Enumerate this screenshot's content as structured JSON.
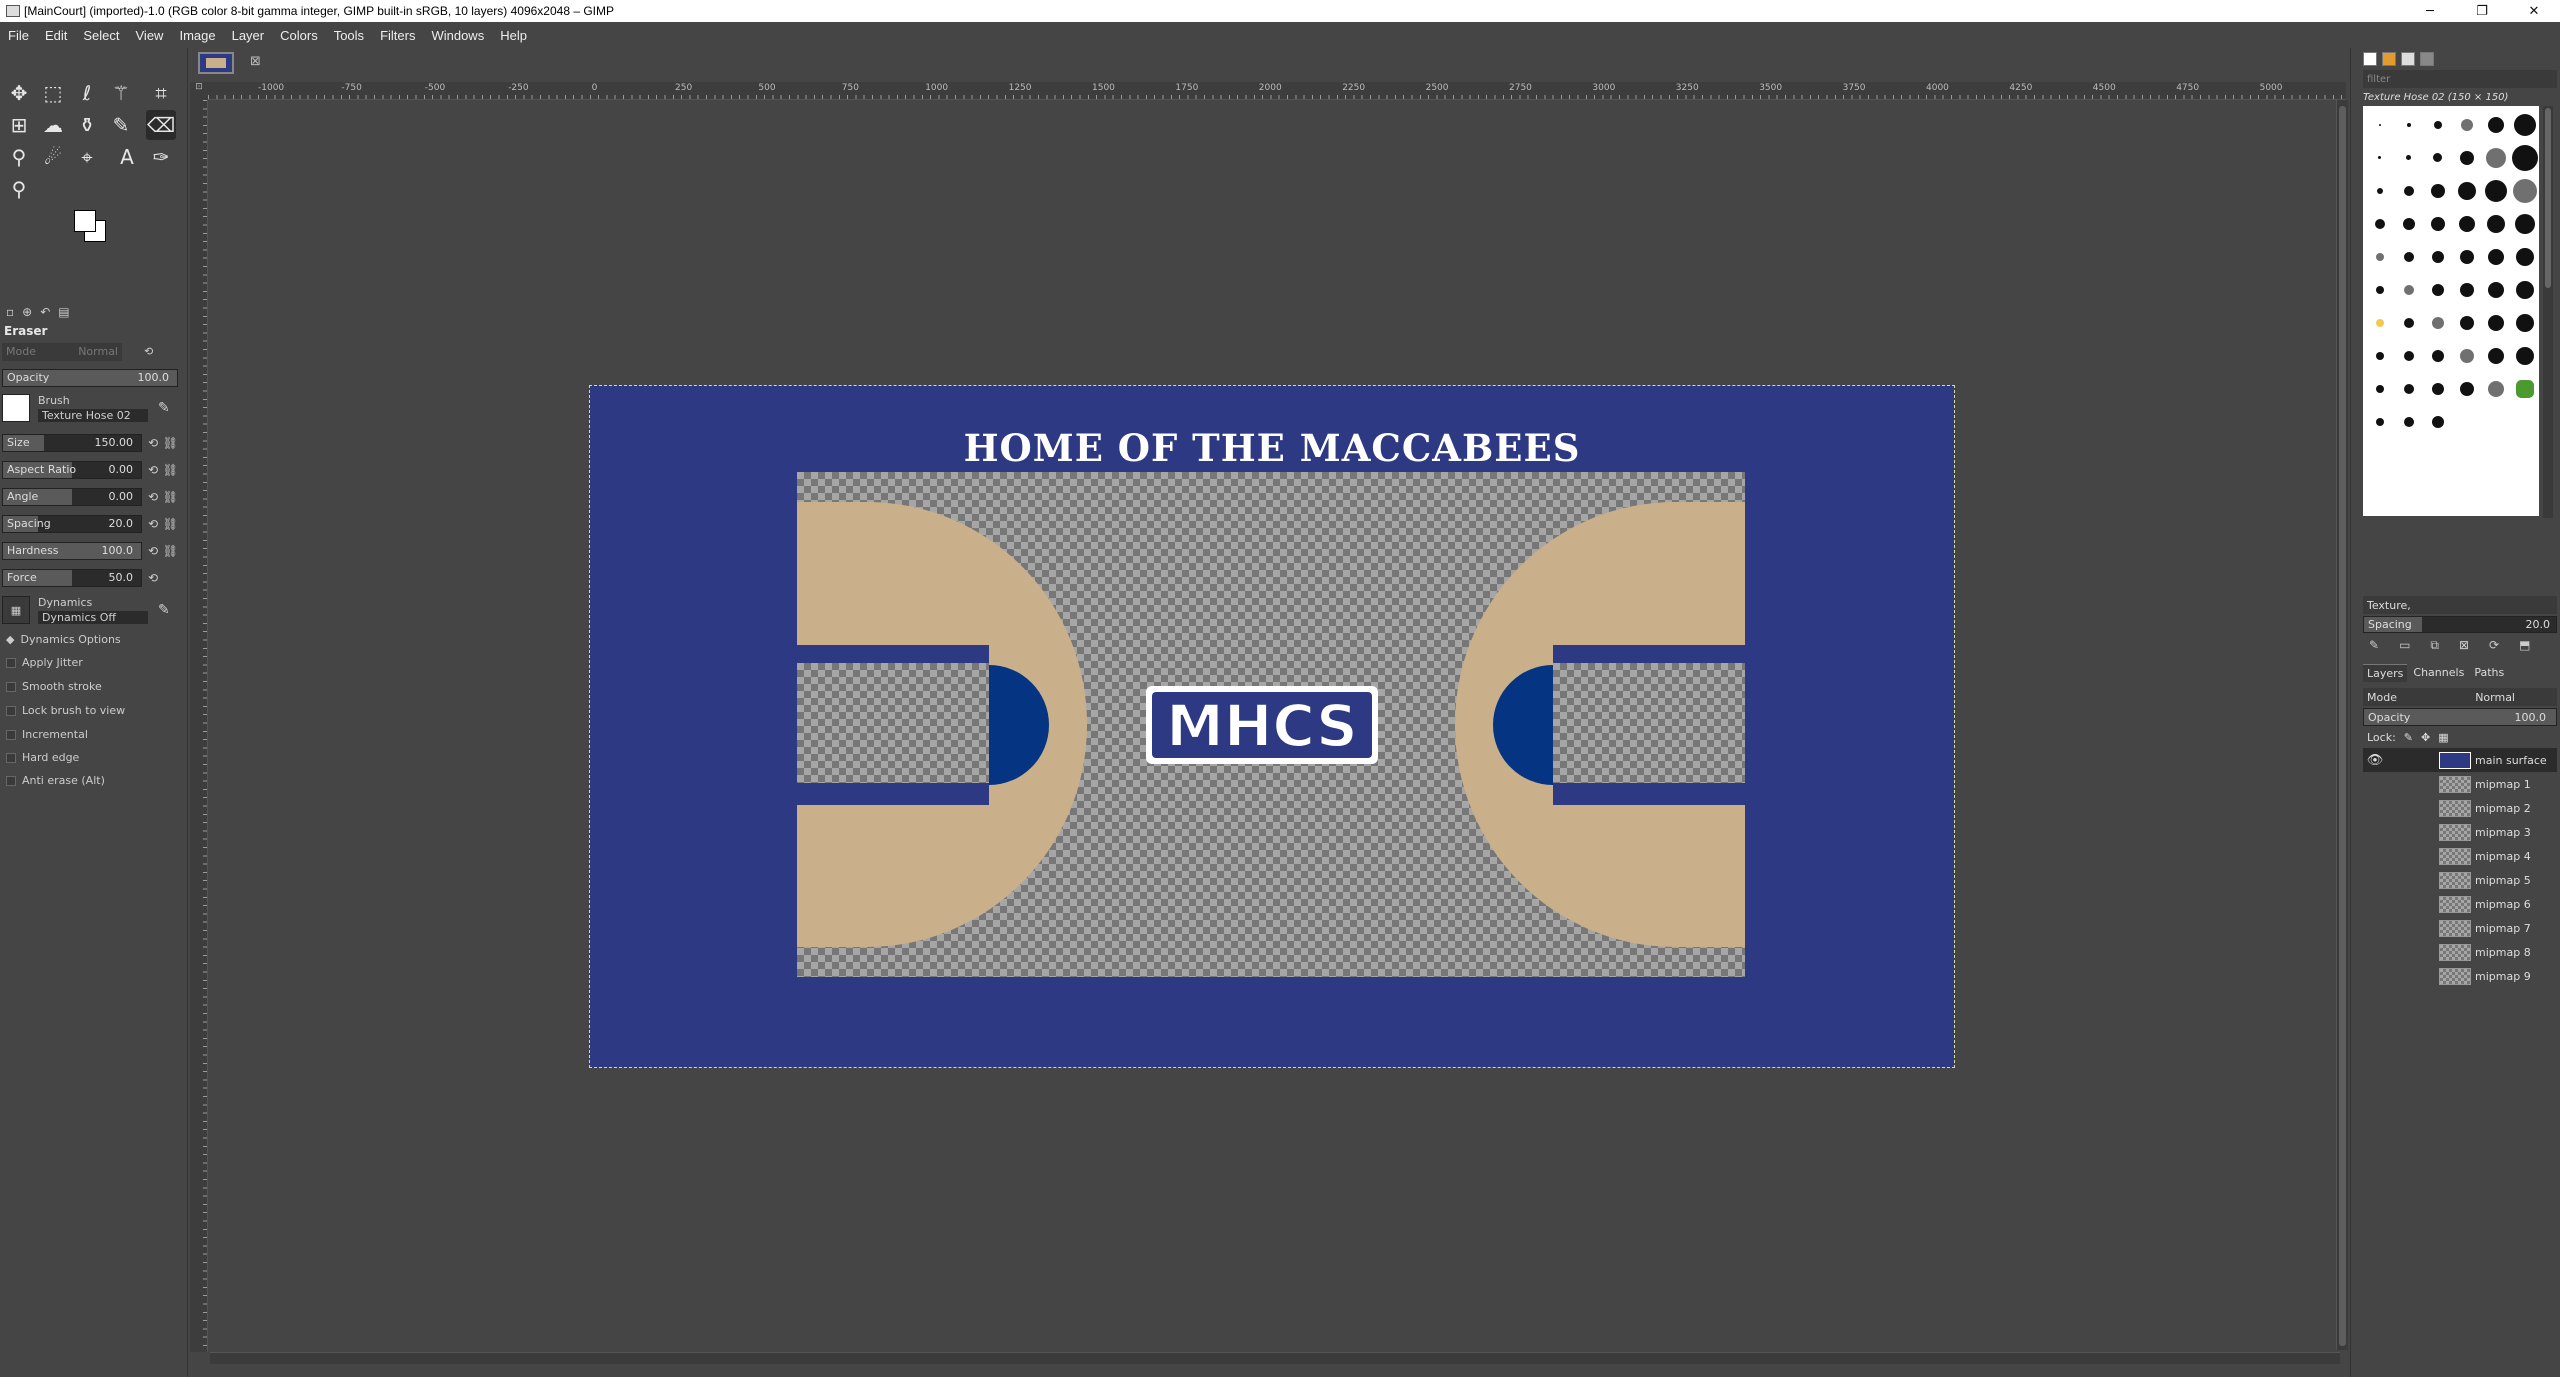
{
  "window": {
    "title": "[MainCourt] (imported)-1.0 (RGB color 8-bit gamma integer, GIMP built-in sRGB, 10 layers) 4096x2048 – GIMP",
    "minimize": "─",
    "maximize": "❐",
    "close": "✕"
  },
  "menu": [
    "File",
    "Edit",
    "Select",
    "View",
    "Image",
    "Layer",
    "Colors",
    "Tools",
    "Filters",
    "Windows",
    "Help"
  ],
  "tool_options": {
    "title": "Eraser",
    "mode_label": "Mode",
    "mode_value": "Normal",
    "opacity_label": "Opacity",
    "opacity_value": "100.0",
    "brush_label": "Brush",
    "brush_value": "Texture Hose 02",
    "size_label": "Size",
    "size_value": "150.00",
    "aspect_label": "Aspect Ratio",
    "aspect_value": "0.00",
    "angle_label": "Angle",
    "angle_value": "0.00",
    "spacing_label": "Spacing",
    "spacing_value": "20.0",
    "hardness_label": "Hardness",
    "hardness_value": "100.0",
    "force_label": "Force",
    "force_value": "50.0",
    "dynamics_label": "Dynamics",
    "dynamics_value": "Dynamics Off",
    "dynamics_options": "Dynamics Options",
    "apply_jitter": "Apply Jitter",
    "smooth_stroke": "Smooth stroke",
    "lock_brush": "Lock brush to view",
    "incremental": "Incremental",
    "hard_edge": "Hard edge",
    "anti_erase": "Anti erase  (Alt)"
  },
  "ruler": {
    "labels": [
      "-1000",
      "-750",
      "-500",
      "-250",
      "0",
      "250",
      "500",
      "750",
      "1000",
      "1250",
      "1500",
      "1750",
      "2000",
      "2250",
      "2500",
      "2750",
      "3000",
      "3250",
      "3500",
      "3750",
      "4000",
      "4250",
      "4500",
      "4750",
      "5000"
    ]
  },
  "canvas": {
    "court_heading": "HOME OF THE MACCABEES",
    "logo_text": "MHCS",
    "colors": {
      "court_blue": "#2e3983",
      "wood": "#c9b08a",
      "key_circle": "#053483"
    }
  },
  "brushes": {
    "filter_placeholder": "filter",
    "current": "Texture Hose 02 (150 × 150)",
    "tag": "Texture,",
    "spacing_label": "Spacing",
    "spacing_value": "20.0"
  },
  "layers": {
    "tabs": [
      "Layers",
      "Channels",
      "Paths"
    ],
    "mode_label": "Mode",
    "mode_value": "Normal",
    "opacity_label": "Opacity",
    "opacity_value": "100.0",
    "lock_label": "Lock:",
    "items": [
      "main surface",
      "mipmap 1",
      "mipmap 2",
      "mipmap 3",
      "mipmap 4",
      "mipmap 5",
      "mipmap 6",
      "mipmap 7",
      "mipmap 8",
      "mipmap 9"
    ]
  }
}
